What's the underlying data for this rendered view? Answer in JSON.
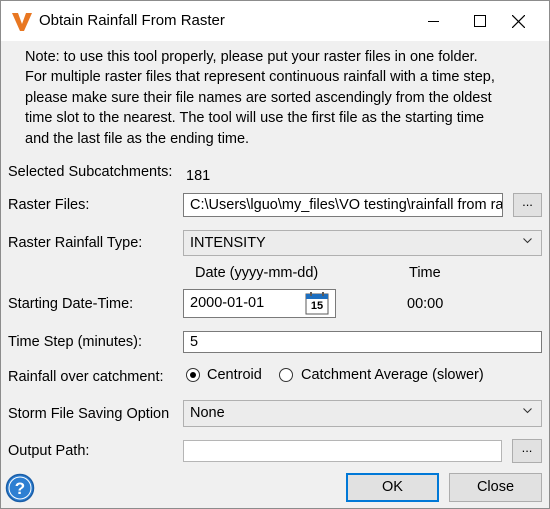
{
  "window": {
    "title": "Obtain Rainfall From Raster",
    "minimize_icon": "minimize-icon",
    "maximize_icon": "maximize-icon",
    "close_icon": "close-icon",
    "app_icon": "app-logo-icon",
    "accent_color": "#e87722"
  },
  "note": {
    "lines": [
      "Note: to use this tool properly, please put your raster files in one folder.",
      "For multiple raster files that represent continuous rainfall with a time step,",
      "please make sure their file names are sorted ascendingly from the oldest",
      "time slot to the nearest. The tool will use the first file as the starting time",
      "and the last file as the ending time."
    ]
  },
  "form": {
    "selected_subcatchments_label": "Selected Subcatchments:",
    "selected_subcatchments_value": "181",
    "raster_files_label": "Raster Files:",
    "raster_files_value": "C:\\Users\\lguo\\my_files\\VO testing\\rainfall from raster",
    "browse_label": "...",
    "rainfall_type_label": "Raster Rainfall Type:",
    "rainfall_type_value": "INTENSITY",
    "date_header": "Date (yyyy-mm-dd)",
    "time_header": "Time",
    "start_label": "Starting Date-Time:",
    "start_date": "2000-01-01",
    "calendar_day": "15",
    "start_time": "00:00",
    "time_step_label": "Time Step (minutes):",
    "time_step_value": "5",
    "rainfall_over_label": "Rainfall over catchment:",
    "option_centroid": "Centroid",
    "option_average": "Catchment Average (slower)",
    "selected_option": "Centroid",
    "storm_saving_label": "Storm File Saving Option",
    "storm_saving_value": "None",
    "output_path_label": "Output Path:",
    "output_path_value": "",
    "output_browse_label": "..."
  },
  "buttons": {
    "ok": "OK",
    "close": "Close",
    "help_icon": "help-icon"
  }
}
